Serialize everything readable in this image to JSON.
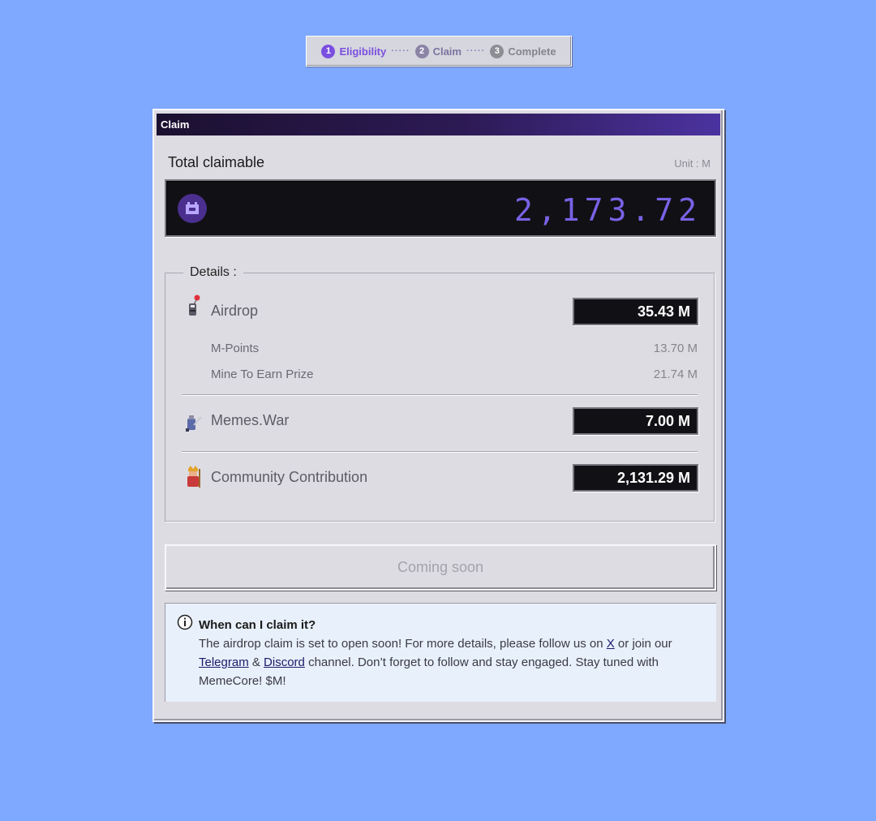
{
  "stepper": {
    "steps": [
      {
        "num": "1",
        "label": "Eligibility"
      },
      {
        "num": "2",
        "label": "Claim"
      },
      {
        "num": "3",
        "label": "Complete"
      }
    ],
    "separator": "·····"
  },
  "window": {
    "title": "Claim",
    "total_label": "Total claimable",
    "unit_label": "Unit : M",
    "total_value": "2,173.72",
    "details": {
      "legend": "Details :",
      "airdrop": {
        "icon": "rocket-character-icon",
        "title": "Airdrop",
        "value": "35.43  M",
        "sub_items": [
          {
            "label": "M-Points",
            "value": "13.70 M"
          },
          {
            "label": "Mine To Earn Prize",
            "value": "21.74 M"
          }
        ]
      },
      "memes_war": {
        "icon": "warrior-character-icon",
        "title": "Memes.War",
        "value": "7.00  M"
      },
      "community": {
        "icon": "king-character-icon",
        "title": "Community Contribution",
        "value": "2,131.29  M"
      }
    },
    "button_label": "Coming soon",
    "info": {
      "title": "When can I claim it?",
      "text_1": "The airdrop claim is set to open soon! For more details, please follow us on ",
      "link_x": "X",
      "text_2": " or join our ",
      "link_telegram": "Telegram",
      "text_3": " & ",
      "link_discord": "Discord",
      "text_4": " channel. Don’t forget to follow and stay engaged. Stay tuned with MemeCore! $M!"
    }
  },
  "colors": {
    "background": "#7fa8ff",
    "accent": "#7a4fe0",
    "digits": "#7a62e6"
  }
}
